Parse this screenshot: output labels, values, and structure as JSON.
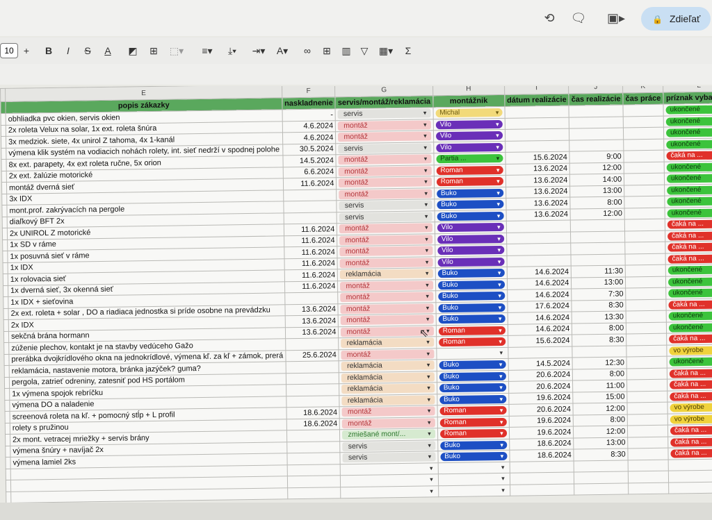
{
  "app": {
    "share_label": "Zdieľať"
  },
  "toolbar": {
    "font_size": "10"
  },
  "columns": {
    "row_label": "",
    "letters": [
      "E",
      "F",
      "G",
      "H",
      "I",
      "J",
      "K",
      "L"
    ]
  },
  "header": [
    "popis zákazky",
    "naskladnenie",
    "servis/montáž/reklamácia",
    "montážnik",
    "dátum realizácie",
    "čas realizácie",
    "čas práce",
    "príznak vybavenia"
  ],
  "colors": {
    "green": "#3cc33c",
    "red": "#e0312a",
    "yellow": "#f0d23c",
    "purple": "#6a2fb8",
    "blue": "#1d4fc4",
    "servis": "#e2e2de",
    "montaz": "#f4c9c9",
    "reklamacia": "#f3dcc3",
    "zmiesane": "#d6ead0",
    "michal": "#f2da7a"
  },
  "rows": [
    {
      "desc": "obhliadka pvc okien, servis okien",
      "date": "-",
      "type": "servis",
      "tech": "Michal",
      "tech_color": "michal",
      "real": "",
      "time": "",
      "work": "",
      "status": "ukončené",
      "status_color": "green"
    },
    {
      "desc": "2x roleta Velux na solar, 1x ext. roleta šnúra",
      "date": "4.6.2024",
      "type": "montáž",
      "tech": "Vilo",
      "tech_color": "purple",
      "real": "",
      "time": "",
      "work": "",
      "status": "ukončené",
      "status_color": "green"
    },
    {
      "desc": "3x medziok. siete, 4x unirol Z tahoma, 4x 1-kanál",
      "date": "4.6.2024",
      "type": "montáž",
      "tech": "Vilo",
      "tech_color": "purple",
      "real": "",
      "time": "",
      "work": "",
      "status": "ukončené",
      "status_color": "green"
    },
    {
      "desc": "výmena klik systém na vodiacich nohách rolety, int. sieť nedrží v spodnej polohe",
      "date": "30.5.2024",
      "type": "servis",
      "tech": "Vilo",
      "tech_color": "purple",
      "real": "",
      "time": "",
      "work": "",
      "status": "ukončené",
      "status_color": "green"
    },
    {
      "desc": "8x ext. parapety, 4x ext roleta ručne, 5x orion",
      "date": "14.5.2024",
      "type": "montáž",
      "tech": "Partia ...",
      "tech_color": "green",
      "real": "15.6.2024",
      "time": "9:00",
      "work": "",
      "status": "čaká na ...",
      "status_color": "red"
    },
    {
      "desc": "2x ext. žalúzie motorické",
      "date": "6.6.2024",
      "type": "montáž",
      "tech": "Roman",
      "tech_color": "red",
      "real": "13.6.2024",
      "time": "12:00",
      "work": "",
      "status": "ukončené",
      "status_color": "green"
    },
    {
      "desc": "montáž dverná sieť",
      "date": "11.6.2024",
      "type": "montáž",
      "tech": "Roman",
      "tech_color": "red",
      "real": "13.6.2024",
      "time": "14:00",
      "work": "",
      "status": "ukončené",
      "status_color": "green"
    },
    {
      "desc": "3x IDX",
      "date": "",
      "type": "montáž",
      "tech": "Buko",
      "tech_color": "blue",
      "real": "13.6.2024",
      "time": "13:00",
      "work": "",
      "status": "ukončené",
      "status_color": "green"
    },
    {
      "desc": "mont.prof. zakrývacích na pergole",
      "date": "",
      "type": "servis",
      "tech": "Buko",
      "tech_color": "blue",
      "real": "13.6.2024",
      "time": "8:00",
      "work": "",
      "status": "ukončené",
      "status_color": "green"
    },
    {
      "desc": "diaľkový BFT 2x",
      "date": "",
      "type": "servis",
      "tech": "Buko",
      "tech_color": "blue",
      "real": "13.6.2024",
      "time": "12:00",
      "work": "",
      "status": "ukončené",
      "status_color": "green"
    },
    {
      "desc": "2x UNIROL Z motorické",
      "date": "11.6.2024",
      "type": "montáž",
      "tech": "Vilo",
      "tech_color": "purple",
      "real": "",
      "time": "",
      "work": "",
      "status": "čaká na ...",
      "status_color": "red"
    },
    {
      "desc": "1x SD v ráme",
      "date": "11.6.2024",
      "type": "montáž",
      "tech": "Vilo",
      "tech_color": "purple",
      "real": "",
      "time": "",
      "work": "",
      "status": "čaká na ...",
      "status_color": "red"
    },
    {
      "desc": "1x posuvná sieť v ráme",
      "date": "11.6.2024",
      "type": "montáž",
      "tech": "Vilo",
      "tech_color": "purple",
      "real": "",
      "time": "",
      "work": "",
      "status": "čaká na ...",
      "status_color": "red"
    },
    {
      "desc": "1x IDX",
      "date": "11.6.2024",
      "type": "montáž",
      "tech": "Vilo",
      "tech_color": "purple",
      "real": "",
      "time": "",
      "work": "",
      "status": "čaká na ...",
      "status_color": "red"
    },
    {
      "desc": "1x rolovacia sieť",
      "date": "11.6.2024",
      "type": "reklamácia",
      "tech": "Buko",
      "tech_color": "blue",
      "real": "14.6.2024",
      "time": "11:30",
      "work": "",
      "status": "ukončené",
      "status_color": "green"
    },
    {
      "desc": "1x dverná sieť, 3x okenná sieť",
      "date": "11.6.2024",
      "type": "montáž",
      "tech": "Buko",
      "tech_color": "blue",
      "real": "14.6.2024",
      "time": "13:00",
      "work": "",
      "status": "ukončené",
      "status_color": "green"
    },
    {
      "desc": "1x IDX + sieťovina",
      "date": "",
      "type": "montáž",
      "tech": "Buko",
      "tech_color": "blue",
      "real": "14.6.2024",
      "time": "7:30",
      "work": "",
      "status": "ukončené",
      "status_color": "green"
    },
    {
      "desc": "2x ext. roleta + solar , DO a riadiaca jednostka si príde osobne na prevádzku",
      "date": "13.6.2024",
      "type": "montáž",
      "tech": "Buko",
      "tech_color": "blue",
      "real": "17.6.2024",
      "time": "8:30",
      "work": "",
      "status": "čaká na ...",
      "status_color": "red"
    },
    {
      "desc": "2x IDX",
      "date": "13.6.2024",
      "type": "montáž",
      "tech": "Buko",
      "tech_color": "blue",
      "real": "14.6.2024",
      "time": "13:30",
      "work": "",
      "status": "ukončené",
      "status_color": "green"
    },
    {
      "desc": "sekčná brána hormann",
      "date": "13.6.2024",
      "type": "montáž",
      "tech": "Roman",
      "tech_color": "red",
      "real": "14.6.2024",
      "time": "8:00",
      "work": "",
      "status": "ukončené",
      "status_color": "green"
    },
    {
      "desc": "zúženie plechov, kontakt je na stavby vedúceho Gažo",
      "date": "",
      "type": "reklamácia",
      "tech": "Roman",
      "tech_color": "red",
      "real": "15.6.2024",
      "time": "8:30",
      "work": "",
      "status": "čaká na ...",
      "status_color": "red"
    },
    {
      "desc": "prerábka dvojkrídlového okna na jednokrídlové, výmena kľ. za kľ + zámok, prerá",
      "date": "25.6.2024",
      "type": "montáž",
      "tech": "",
      "tech_color": "",
      "real": "",
      "time": "",
      "work": "",
      "status": "vo výrobe",
      "status_color": "yellow"
    },
    {
      "desc": "reklamácia, nastavenie motora, bránka jazýček? guma?",
      "date": "",
      "type": "reklamácia",
      "tech": "Buko",
      "tech_color": "blue",
      "real": "14.5.2024",
      "time": "12:30",
      "work": "",
      "status": "ukončené",
      "status_color": "green"
    },
    {
      "desc": "pergola, zatrieť odreniny, zatesniť pod HS portálom",
      "date": "",
      "type": "reklamácia",
      "tech": "Buko",
      "tech_color": "blue",
      "real": "20.6.2024",
      "time": "8:00",
      "work": "",
      "status": "čaká na ...",
      "status_color": "red"
    },
    {
      "desc": "1x výmena spojok rebríčku",
      "date": "",
      "type": "reklamácia",
      "tech": "Buko",
      "tech_color": "blue",
      "real": "20.6.2024",
      "time": "11:00",
      "work": "",
      "status": "čaká na ...",
      "status_color": "red"
    },
    {
      "desc": "výmena DO a naladenie",
      "date": "",
      "type": "reklamácia",
      "tech": "Buko",
      "tech_color": "blue",
      "real": "19.6.2024",
      "time": "15:00",
      "work": "",
      "status": "čaká na ...",
      "status_color": "red"
    },
    {
      "desc": "screenová roleta na kľ. + pomocný stĺp + L profil",
      "date": "18.6.2024",
      "type": "montáž",
      "tech": "Roman",
      "tech_color": "red",
      "real": "20.6.2024",
      "time": "12:00",
      "work": "",
      "status": "vo výrobe",
      "status_color": "yellow"
    },
    {
      "desc": "rolety s pružinou",
      "date": "18.6.2024",
      "type": "montáž",
      "tech": "Roman",
      "tech_color": "red",
      "real": "19.6.2024",
      "time": "8:00",
      "work": "",
      "status": "vo výrobe",
      "status_color": "yellow"
    },
    {
      "desc": "2x mont. vetracej mriežky + servis brány",
      "date": "",
      "type": "zmiešané mont/...",
      "tech": "Roman",
      "tech_color": "red",
      "real": "19.6.2024",
      "time": "12:00",
      "work": "",
      "status": "čaká na ...",
      "status_color": "red"
    },
    {
      "desc": "výmena šnúry + navíjač 2x",
      "date": "",
      "type": "servis",
      "tech": "Buko",
      "tech_color": "blue",
      "real": "18.6.2024",
      "time": "13:00",
      "work": "",
      "status": "čaká na ...",
      "status_color": "red"
    },
    {
      "desc": "výmena lamiel 2ks",
      "date": "",
      "type": "servis",
      "tech": "Buko",
      "tech_color": "blue",
      "real": "18.6.2024",
      "time": "8:30",
      "work": "",
      "status": "čaká na ...",
      "status_color": "red"
    },
    {
      "desc": "",
      "date": "",
      "type": "",
      "tech": "",
      "tech_color": "",
      "real": "",
      "time": "",
      "work": "",
      "status": "",
      "status_color": ""
    },
    {
      "desc": "",
      "date": "",
      "type": "",
      "tech": "",
      "tech_color": "",
      "real": "",
      "time": "",
      "work": "",
      "status": "",
      "status_color": ""
    },
    {
      "desc": "",
      "date": "",
      "type": "",
      "tech": "",
      "tech_color": "",
      "real": "",
      "time": "",
      "work": "",
      "status": "",
      "status_color": ""
    }
  ]
}
